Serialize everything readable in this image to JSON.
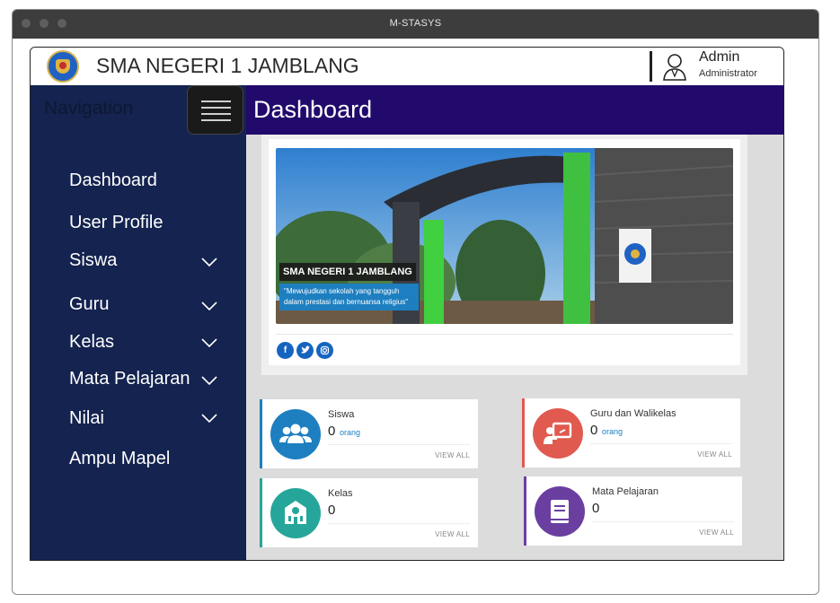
{
  "window": {
    "title": "M-STASYS"
  },
  "header": {
    "school_name": "SMA NEGERI 1 JAMBLANG",
    "user_name": "Admin",
    "user_role": "Administrator"
  },
  "sidebar": {
    "heading": "Navigation",
    "items": [
      {
        "label": "Dashboard",
        "has_dropdown": false
      },
      {
        "label": "User Profile",
        "has_dropdown": false
      },
      {
        "label": "Siswa",
        "has_dropdown": true
      },
      {
        "label": "Guru",
        "has_dropdown": true
      },
      {
        "label": "Kelas",
        "has_dropdown": true
      },
      {
        "label": "Mata Pelajaran",
        "has_dropdown": true
      },
      {
        "label": "Nilai",
        "has_dropdown": true
      },
      {
        "label": "Ampu Mapel",
        "has_dropdown": false
      }
    ]
  },
  "main": {
    "title": "Dashboard",
    "hero": {
      "caption_title": "SMA NEGERI 1 JAMBLANG",
      "caption_text": "\"Mewujudkan sekolah yang tangguh dalam prestasi dan bernuansa religius\"",
      "social": [
        "facebook-icon",
        "twitter-icon",
        "instagram-icon"
      ]
    },
    "stats": [
      {
        "label": "Siswa",
        "value": "0",
        "unit": "orang",
        "link": "VIEW ALL",
        "color": "#1e7fc0",
        "icon": "users-icon"
      },
      {
        "label": "Guru dan Walikelas",
        "value": "0",
        "unit": "orang",
        "link": "VIEW ALL",
        "color": "#e05a4f",
        "icon": "teacher-board-icon"
      },
      {
        "label": "Kelas",
        "value": "0",
        "unit": "",
        "link": "VIEW ALL",
        "color": "#26a69a",
        "icon": "school-building-icon"
      },
      {
        "label": "Mata Pelajaran",
        "value": "0",
        "unit": "",
        "link": "VIEW ALL",
        "color": "#6a3fa0",
        "icon": "book-icon"
      }
    ]
  },
  "colors": {
    "sidebar_bg": "#14234f",
    "header_bg": "#220a6c",
    "content_bg": "#dcdcdc"
  }
}
